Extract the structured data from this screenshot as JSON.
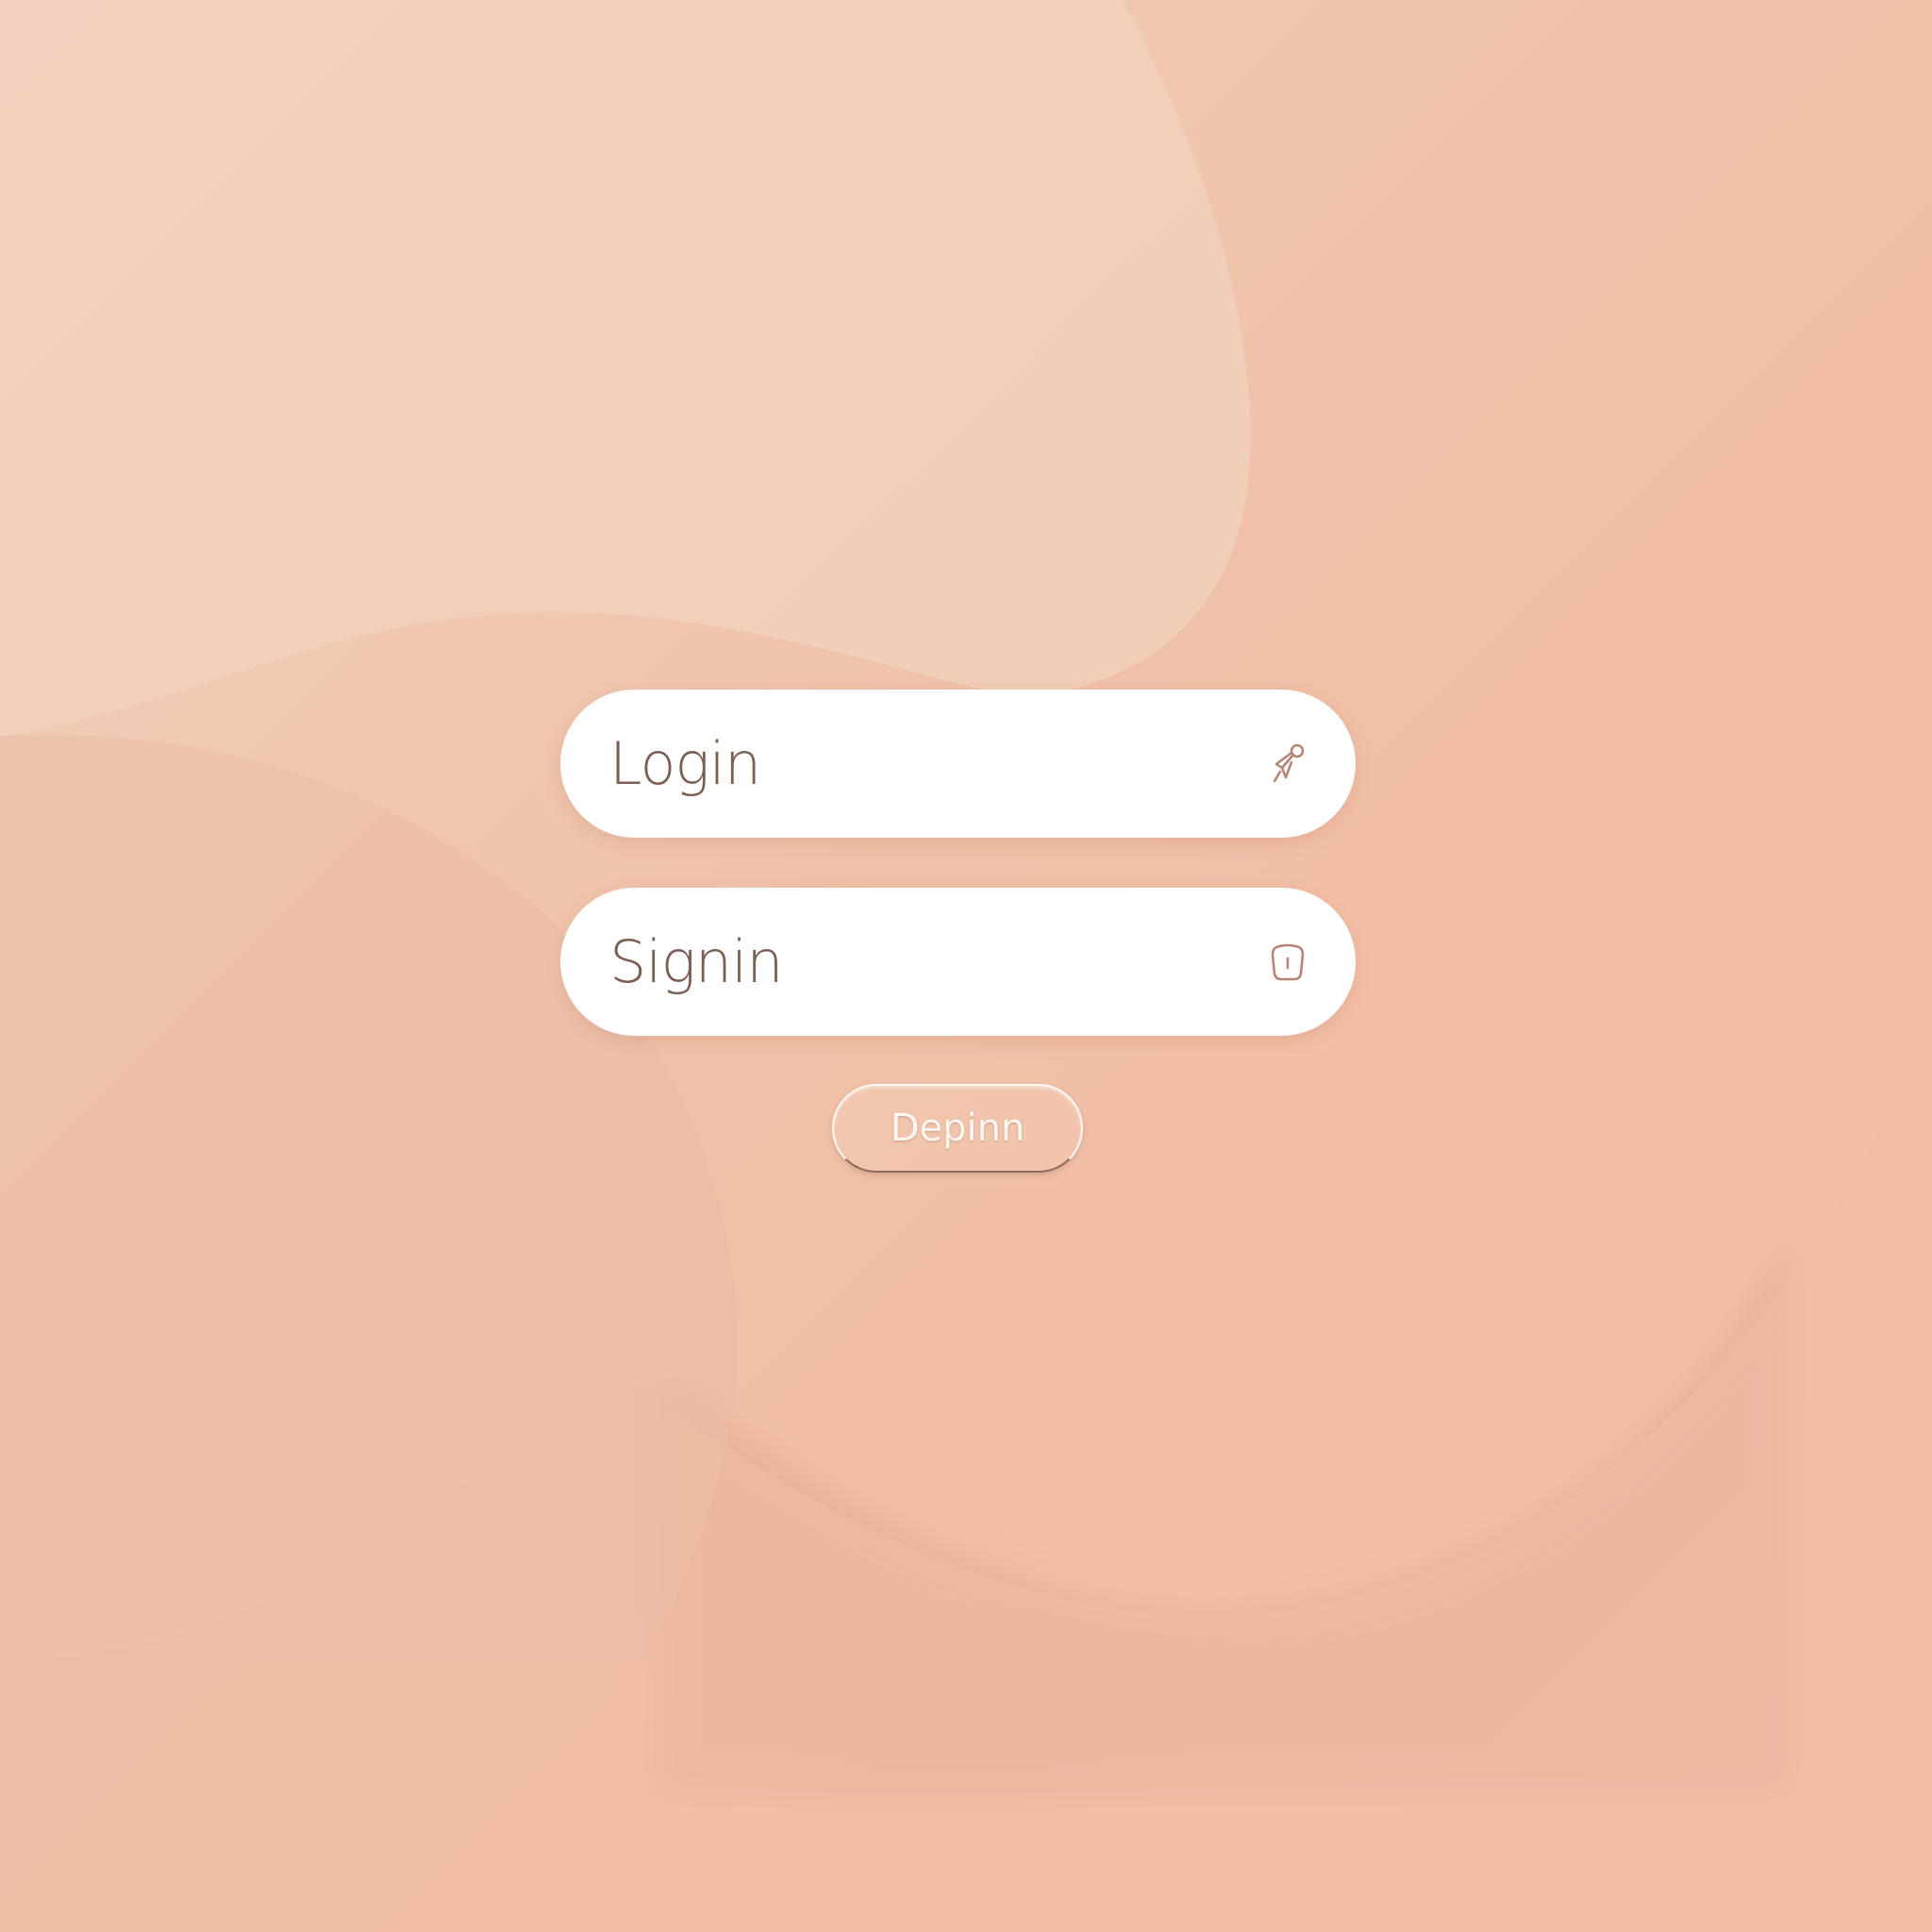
{
  "login_field": {
    "text": "Login",
    "icon": "pin-icon"
  },
  "signin_field": {
    "text": "Signin",
    "icon": "phone-icon"
  },
  "submit_button": {
    "label": "Depinn"
  },
  "colors": {
    "background": "#f1c4ab",
    "field_background": "#ffffff",
    "field_text": "#7c5e52",
    "icon_stroke": "#b58373",
    "button_text": "#fdf5f0"
  }
}
